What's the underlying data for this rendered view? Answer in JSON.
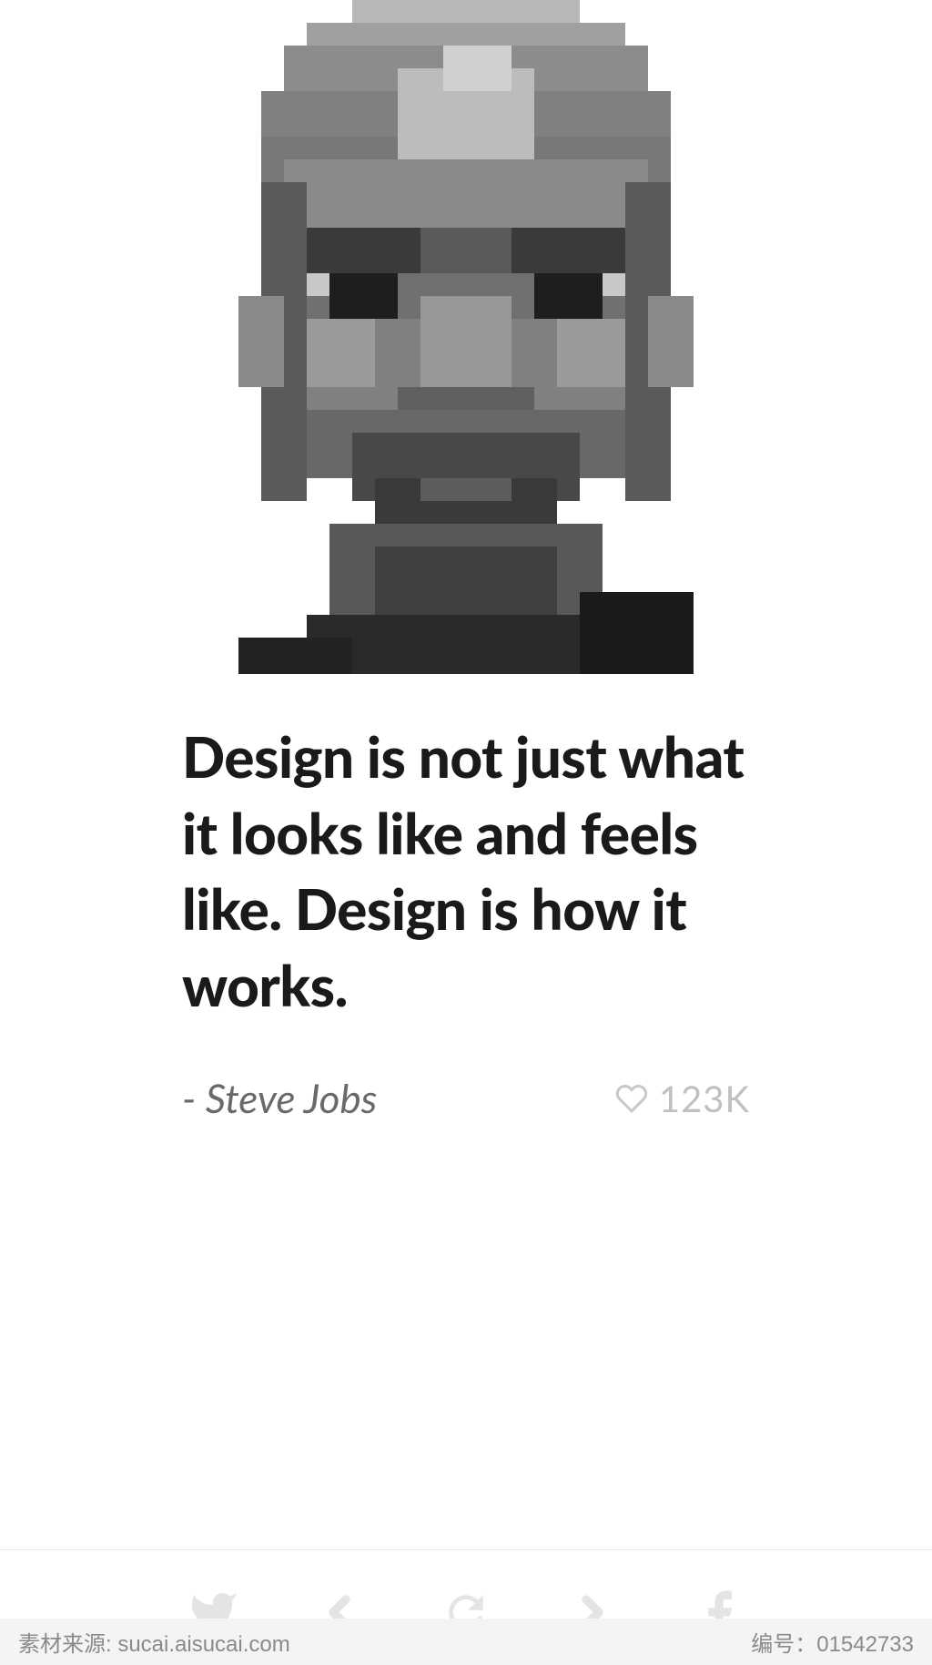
{
  "quote": {
    "text": "Design is not just what it looks like and feels like. Design is how it works.",
    "author": "- Steve Jobs"
  },
  "likes": {
    "count": "123K"
  },
  "footer": {
    "brand": "素材来源: sucai.aisucai.com",
    "id_label": "编号：",
    "id_value": "01542733"
  },
  "colors": {
    "text_primary": "#1a1a1a",
    "text_secondary": "#6a6a6a",
    "text_muted": "#c0c0c0",
    "icon_muted": "#e4e4e4",
    "divider": "#e8e8e8",
    "footer_bg": "#f4f4f4"
  }
}
